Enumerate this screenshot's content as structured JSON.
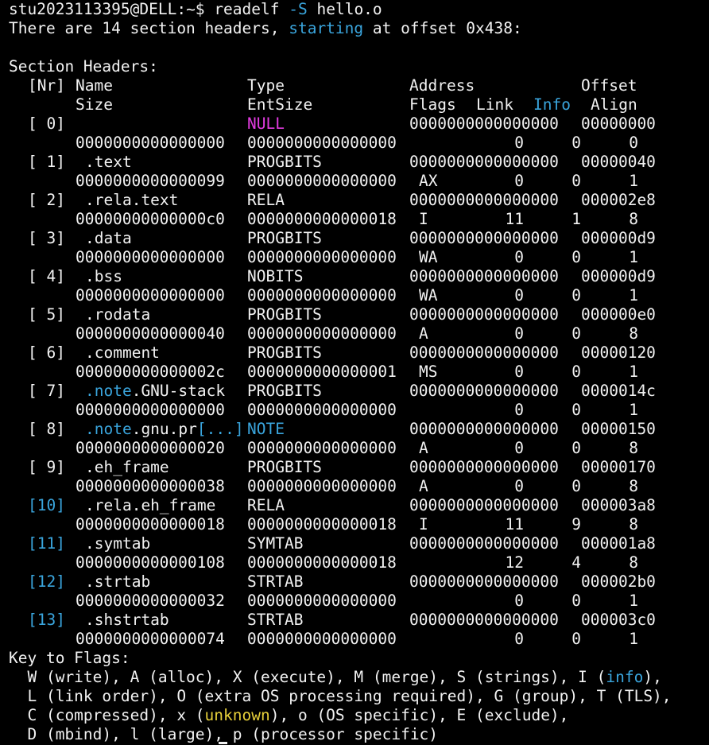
{
  "window": {
    "background": "#000000",
    "text_color": "#f2f2f2",
    "accent_cyan": "#3aa5dd",
    "accent_magenta": "#e23ce0",
    "accent_yellow": "#e7d03a"
  },
  "prompt": {
    "user_host": "stu2023113395@DELL",
    "path": ":~$",
    "cmd": "readelf",
    "flag": "-S",
    "file": "hello.o"
  },
  "summary": {
    "pre": "There are 14 section headers,",
    "highlight": "starting",
    "post": "at offset 0x438:"
  },
  "section_heading": "Section Headers:",
  "header1": {
    "nr": "[Nr]",
    "name": "Name",
    "type": "Type",
    "address": "Address",
    "offset": "Offset"
  },
  "header2": {
    "size": "Size",
    "entsize": "EntSize",
    "flags": "Flags",
    "link": "Link",
    "info": "Info",
    "align": "Align"
  },
  "sections": [
    {
      "nr": "[ 0]",
      "name_pre": "",
      "name_hl": "",
      "name_post": "",
      "name_more": "",
      "type": "NULL",
      "type_color": "magenta",
      "address": "0000000000000000",
      "offset": "00000000",
      "size": "0000000000000000",
      "entsize": "0000000000000000",
      "flags": "",
      "link": "0",
      "info": "0",
      "align": "0"
    },
    {
      "nr": "[ 1]",
      "name_pre": ".text",
      "name_hl": "",
      "name_post": "",
      "name_more": "",
      "type": "PROGBITS",
      "type_color": "",
      "address": "0000000000000000",
      "offset": "00000040",
      "size": "0000000000000099",
      "entsize": "0000000000000000",
      "flags": "AX",
      "link": "0",
      "info": "0",
      "align": "1"
    },
    {
      "nr": "[ 2]",
      "name_pre": ".rela.text",
      "name_hl": "",
      "name_post": "",
      "name_more": "",
      "type": "RELA",
      "type_color": "",
      "address": "0000000000000000",
      "offset": "000002e8",
      "size": "00000000000000c0",
      "entsize": "0000000000000018",
      "flags": "I",
      "link": "11",
      "info": "1",
      "align": "8"
    },
    {
      "nr": "[ 3]",
      "name_pre": ".data",
      "name_hl": "",
      "name_post": "",
      "name_more": "",
      "type": "PROGBITS",
      "type_color": "",
      "address": "0000000000000000",
      "offset": "000000d9",
      "size": "0000000000000000",
      "entsize": "0000000000000000",
      "flags": "WA",
      "link": "0",
      "info": "0",
      "align": "1"
    },
    {
      "nr": "[ 4]",
      "name_pre": ".bss",
      "name_hl": "",
      "name_post": "",
      "name_more": "",
      "type": "NOBITS",
      "type_color": "",
      "address": "0000000000000000",
      "offset": "000000d9",
      "size": "0000000000000000",
      "entsize": "0000000000000000",
      "flags": "WA",
      "link": "0",
      "info": "0",
      "align": "1"
    },
    {
      "nr": "[ 5]",
      "name_pre": ".rodata",
      "name_hl": "",
      "name_post": "",
      "name_more": "",
      "type": "PROGBITS",
      "type_color": "",
      "address": "0000000000000000",
      "offset": "000000e0",
      "size": "0000000000000040",
      "entsize": "0000000000000000",
      "flags": "A",
      "link": "0",
      "info": "0",
      "align": "8"
    },
    {
      "nr": "[ 6]",
      "name_pre": ".comment",
      "name_hl": "",
      "name_post": "",
      "name_more": "",
      "type": "PROGBITS",
      "type_color": "",
      "address": "0000000000000000",
      "offset": "00000120",
      "size": "000000000000002c",
      "entsize": "0000000000000001",
      "flags": "MS",
      "link": "0",
      "info": "0",
      "align": "1"
    },
    {
      "nr": "[ 7]",
      "name_pre": "",
      "name_hl": ".note",
      "name_post": ".GNU-stack",
      "name_more": "",
      "type": "PROGBITS",
      "type_color": "",
      "address": "0000000000000000",
      "offset": "0000014c",
      "size": "0000000000000000",
      "entsize": "0000000000000000",
      "flags": "",
      "link": "0",
      "info": "0",
      "align": "1"
    },
    {
      "nr": "[ 8]",
      "name_pre": "",
      "name_hl": ".note",
      "name_post": ".gnu.pr",
      "name_more": "[...]",
      "type": "NOTE",
      "type_color": "cyan",
      "address": "0000000000000000",
      "offset": "00000150",
      "size": "0000000000000020",
      "entsize": "0000000000000000",
      "flags": "A",
      "link": "0",
      "info": "0",
      "align": "8"
    },
    {
      "nr": "[ 9]",
      "name_pre": ".eh_frame",
      "name_hl": "",
      "name_post": "",
      "name_more": "",
      "type": "PROGBITS",
      "type_color": "",
      "address": "0000000000000000",
      "offset": "00000170",
      "size": "0000000000000038",
      "entsize": "0000000000000000",
      "flags": "A",
      "link": "0",
      "info": "0",
      "align": "8"
    },
    {
      "nr": "[10]",
      "nr_color": "cyan",
      "name_pre": ".rela.eh_frame",
      "name_hl": "",
      "name_post": "",
      "name_more": "",
      "type": "RELA",
      "type_color": "",
      "address": "0000000000000000",
      "offset": "000003a8",
      "size": "0000000000000018",
      "entsize": "0000000000000018",
      "flags": "I",
      "link": "11",
      "info": "9",
      "align": "8"
    },
    {
      "nr": "[11]",
      "nr_color": "cyan",
      "name_pre": ".symtab",
      "name_hl": "",
      "name_post": "",
      "name_more": "",
      "type": "SYMTAB",
      "type_color": "",
      "address": "0000000000000000",
      "offset": "000001a8",
      "size": "0000000000000108",
      "entsize": "0000000000000018",
      "flags": "",
      "link": "12",
      "info": "4",
      "align": "8"
    },
    {
      "nr": "[12]",
      "nr_color": "cyan",
      "name_pre": ".strtab",
      "name_hl": "",
      "name_post": "",
      "name_more": "",
      "type": "STRTAB",
      "type_color": "",
      "address": "0000000000000000",
      "offset": "000002b0",
      "size": "0000000000000032",
      "entsize": "0000000000000000",
      "flags": "",
      "link": "0",
      "info": "0",
      "align": "1"
    },
    {
      "nr": "[13]",
      "nr_color": "cyan",
      "name_pre": ".shstrtab",
      "name_hl": "",
      "name_post": "",
      "name_more": "",
      "type": "STRTAB",
      "type_color": "",
      "address": "0000000000000000",
      "offset": "000003c0",
      "size": "0000000000000074",
      "entsize": "0000000000000000",
      "flags": "",
      "link": "0",
      "info": "0",
      "align": "1"
    }
  ],
  "key": {
    "heading": "Key to Flags:",
    "l1_pre": "  W (write), A (alloc), X (execute), M (merge), S (strings), I (",
    "l1_hl": "info",
    "l1_post": "),",
    "l2": "  L (link order), O (extra OS processing required), G (group), T (TLS),",
    "l3_pre": "  C (compressed), x (",
    "l3_hl": "unknown",
    "l3_post": "), o (OS specific), E (exclude),",
    "l4": "  D (mbind), l (large), p (processor specific)"
  }
}
